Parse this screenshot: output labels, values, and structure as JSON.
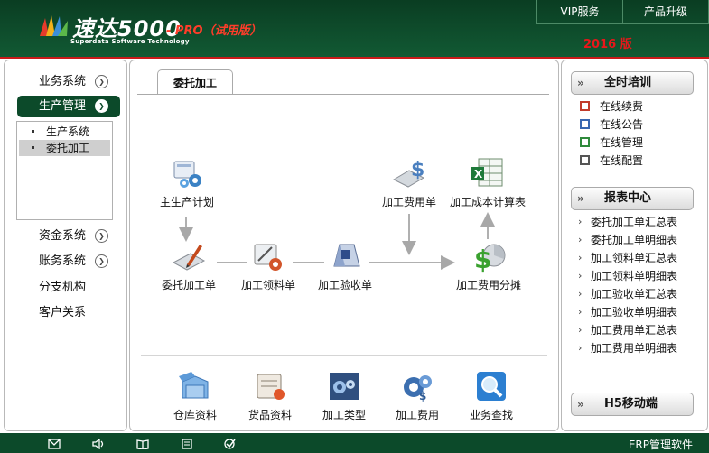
{
  "brand": {
    "name": "速达5000",
    "edition_tag": "- PRO（试用版）",
    "subtitle": "Superdata Software Technology",
    "year_label": "2016 版"
  },
  "top_nav": [
    "VIP服务",
    "产品升级"
  ],
  "sidebar": {
    "items": [
      {
        "label": "业务系统",
        "expandable": true
      },
      {
        "label": "生产管理",
        "expandable": true,
        "active": true
      },
      {
        "label": "资金系统",
        "expandable": true
      },
      {
        "label": "账务系统",
        "expandable": true
      },
      {
        "label": "分支机构",
        "expandable": false
      },
      {
        "label": "客户关系",
        "expandable": false
      }
    ],
    "submenu": [
      {
        "label": "生产系统",
        "selected": false
      },
      {
        "label": "委托加工",
        "selected": true
      }
    ]
  },
  "main": {
    "tab_label": "委托加工",
    "flow_nodes": [
      {
        "label": "主生产计划",
        "icon": "production-plan-icon"
      },
      {
        "label": "委托加工单",
        "icon": "outsourcing-order-icon"
      },
      {
        "label": "加工领料单",
        "icon": "material-requisition-icon"
      },
      {
        "label": "加工验收单",
        "icon": "acceptance-icon"
      },
      {
        "label": "加工费用单",
        "icon": "processing-fee-icon"
      },
      {
        "label": "加工成本计算表",
        "icon": "cost-sheet-icon"
      },
      {
        "label": "加工费用分摊",
        "icon": "fee-allocation-icon"
      }
    ],
    "bottom_tools": [
      {
        "label": "仓库资料",
        "icon": "warehouse-icon"
      },
      {
        "label": "货品资料",
        "icon": "goods-icon"
      },
      {
        "label": "加工类型",
        "icon": "process-type-icon"
      },
      {
        "label": "加工费用",
        "icon": "fee-gear-icon"
      },
      {
        "label": "业务查找",
        "icon": "search-icon"
      }
    ]
  },
  "right_panel": {
    "training": {
      "title": "全时培训",
      "items": [
        "在线续费",
        "在线公告",
        "在线管理",
        "在线配置"
      ]
    },
    "reports": {
      "title": "报表中心",
      "items": [
        "委托加工单汇总表",
        "委托加工单明细表",
        "加工领料单汇总表",
        "加工领料单明细表",
        "加工验收单汇总表",
        "加工验收单明细表",
        "加工费用单汇总表",
        "加工费用单明细表"
      ]
    },
    "mobile": {
      "title": "H5移动端"
    }
  },
  "status_bar": {
    "icons": [
      "mail-icon",
      "speaker-icon",
      "book-icon",
      "document-icon",
      "check-icon"
    ],
    "product": "ERP管理软件"
  },
  "colors": {
    "brand_green": "#0c4a2a",
    "accent_red": "#e8171a"
  }
}
